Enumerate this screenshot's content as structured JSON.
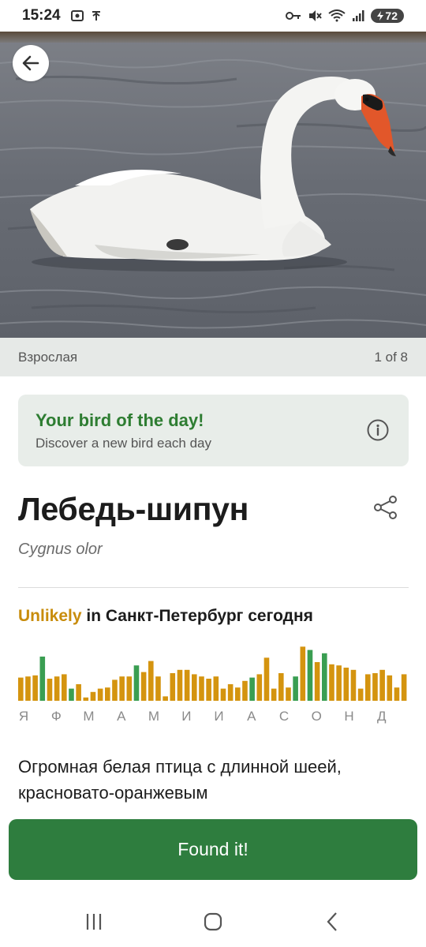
{
  "status_bar": {
    "time": "15:24",
    "battery": "72",
    "icons": [
      "screenshot-icon",
      "signal-t-icon",
      "key-icon",
      "mute-icon",
      "wifi-icon",
      "cell-signal-icon",
      "battery-icon"
    ]
  },
  "photo": {
    "subject": "mute-swan-photo",
    "caption": "Взрослая",
    "counter": "1 of 8"
  },
  "bird_of_day": {
    "title": "Your bird of the day!",
    "subtitle": "Discover a new bird each day",
    "icon": "info-icon"
  },
  "bird": {
    "name": "Лебедь-шипун",
    "latin": "Cygnus olor"
  },
  "likelihood": {
    "status": "Unlikely",
    "location_text": " in Санкт-Петербург сегодня"
  },
  "chart_data": {
    "type": "bar",
    "title": "",
    "months": [
      "Я",
      "Ф",
      "М",
      "А",
      "М",
      "И",
      "И",
      "А",
      "С",
      "О",
      "Н",
      "Д"
    ],
    "values": [
      0.42,
      0.44,
      0.46,
      0.8,
      0.4,
      0.44,
      0.48,
      0.22,
      0.3,
      0.06,
      0.16,
      0.22,
      0.24,
      0.38,
      0.44,
      0.44,
      0.64,
      0.52,
      0.72,
      0.44,
      0.08,
      0.5,
      0.56,
      0.56,
      0.48,
      0.44,
      0.4,
      0.44,
      0.22,
      0.3,
      0.24,
      0.36,
      0.42,
      0.48,
      0.78,
      0.22,
      0.5,
      0.24,
      0.44,
      0.98,
      0.92,
      0.7,
      0.86,
      0.66,
      0.64,
      0.6,
      0.56,
      0.22,
      0.48,
      0.5,
      0.56,
      0.46,
      0.24,
      0.48
    ],
    "highlighted": [
      3,
      7,
      16,
      32,
      38,
      40,
      42
    ],
    "colors": {
      "normal": "#d4940f",
      "highlight": "#3a9e52"
    }
  },
  "description": "Огромная белая птица с длинной шеей, красновато-оранжевым",
  "found_button": {
    "label": "Found it!"
  },
  "nav": {
    "icons": [
      "recents-icon",
      "home-icon",
      "back-icon"
    ]
  }
}
